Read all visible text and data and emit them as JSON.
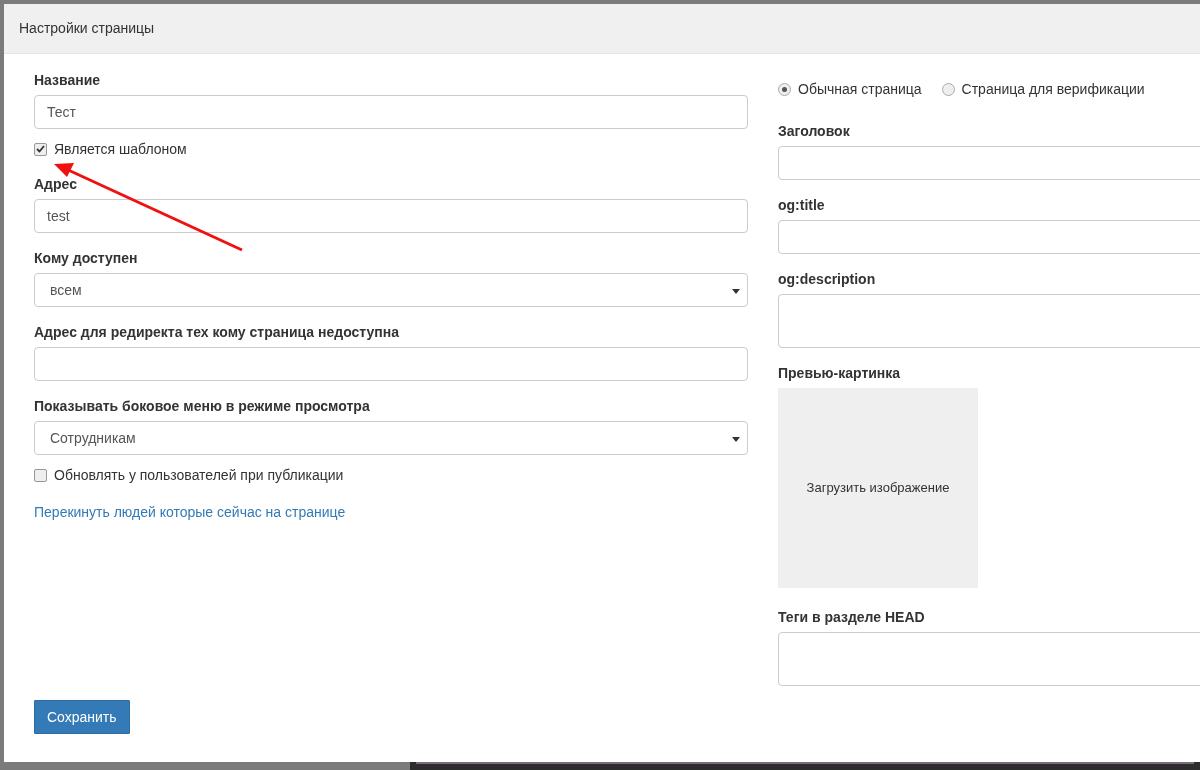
{
  "dialog": {
    "title": "Настройки страницы"
  },
  "left_fields": [
    {
      "kind": "input",
      "label": "Название",
      "value": "Тест"
    },
    {
      "kind": "checkbox",
      "label": "Является шаблоном",
      "checked": true
    },
    {
      "kind": "input",
      "label": "Адрес",
      "value": "test"
    },
    {
      "kind": "select",
      "label": "Кому доступен",
      "value": "всем"
    },
    {
      "kind": "input",
      "label": "Адрес для редиректа тех кому страница недоступна"
    },
    {
      "kind": "select",
      "label": "Показывать боковое меню в режиме просмотра",
      "value": "Сотрудникам"
    },
    {
      "kind": "checkbox",
      "label": "Обновлять у пользователей при публикации",
      "checked": false
    },
    {
      "kind": "link",
      "label": "Перекинуть людей которые сейчас на странице"
    }
  ],
  "page_type": [
    {
      "label": "Обычная страница",
      "selected": true
    },
    {
      "label": "Страница для верификации",
      "selected": false
    }
  ],
  "right_fields": [
    {
      "kind": "input",
      "label": "Заголовок"
    },
    {
      "kind": "input",
      "label": "og:title"
    },
    {
      "kind": "textarea",
      "label": "og:description"
    },
    {
      "kind": "image",
      "label": "Превью-картинка",
      "button": "Загрузить изображение"
    },
    {
      "kind": "textarea",
      "label": "Теги в разделе HEAD"
    }
  ],
  "save_button": "Сохранить"
}
